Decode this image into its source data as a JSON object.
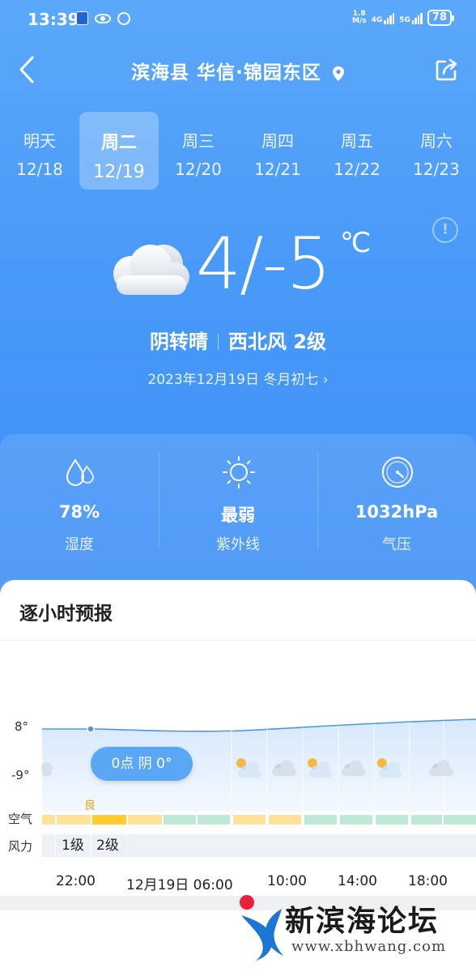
{
  "status_bar": {
    "time": "13:39",
    "net_speed_value": "1.8",
    "net_speed_unit": "M/s",
    "signal1": "4G",
    "signal2": "5G",
    "battery": "78"
  },
  "header": {
    "location": "滨海县 华信·锦园东区"
  },
  "tabs": [
    {
      "day": "明天",
      "date": "12/18"
    },
    {
      "day": "周二",
      "date": "12/19"
    },
    {
      "day": "周三",
      "date": "12/20"
    },
    {
      "day": "周四",
      "date": "12/21"
    },
    {
      "day": "周五",
      "date": "12/22"
    },
    {
      "day": "周六",
      "date": "12/23"
    }
  ],
  "current": {
    "temp_range": "4/-5",
    "unit": "℃",
    "condition": "阴转晴",
    "wind": "西北风 2级",
    "date_line": "2023年12月19日 冬月初七 ›"
  },
  "metrics": [
    {
      "value": "78%",
      "label": "湿度",
      "icon": "humidity-icon"
    },
    {
      "value": "最弱",
      "label": "紫外线",
      "icon": "sun-icon"
    },
    {
      "value": "1032hPa",
      "label": "气压",
      "icon": "pressure-gauge-icon"
    }
  ],
  "hourly": {
    "title": "逐小时预报",
    "y_high": "8°",
    "y_low": "-9°",
    "tooltip": "0点 阴 0°",
    "air_label": "空气",
    "air_quality_text": "良",
    "wind_label": "风力",
    "wind_levels": [
      "1级",
      "2级"
    ],
    "x_labels": [
      "22:00",
      "12月19日 06:00",
      "10:00",
      "14:00",
      "18:00"
    ],
    "colors": {
      "aqi_good": "#ffe199",
      "aqi_good_active": "#ffcc33",
      "aqi_excellent": "#bfe8d6",
      "line": "#4a98e6"
    }
  },
  "watermark": {
    "title": "新滨海论坛",
    "url": "www.xbhwang.com"
  }
}
